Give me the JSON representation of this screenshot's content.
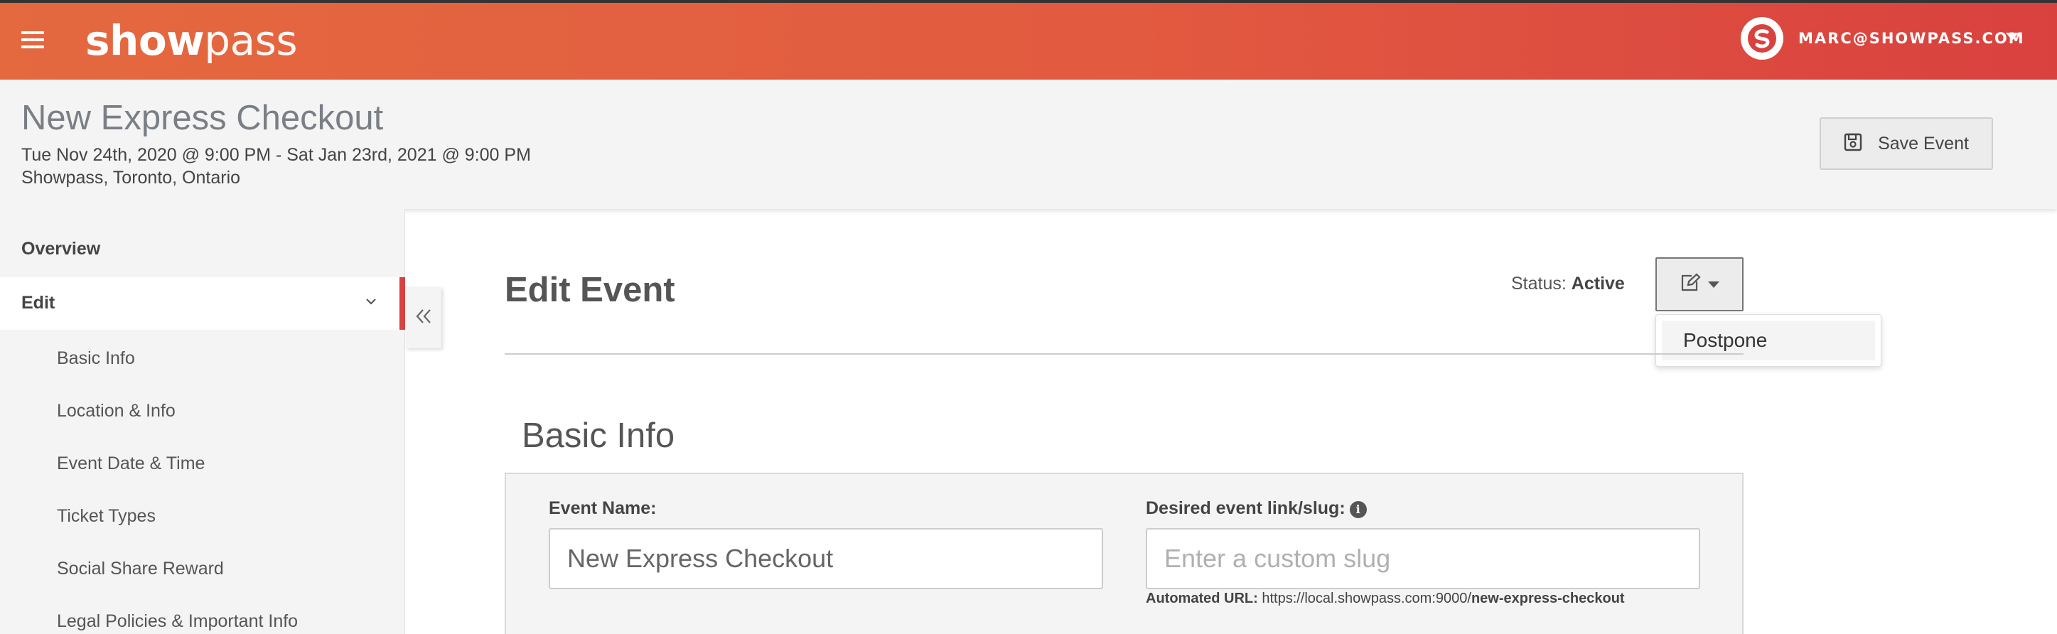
{
  "topbar": {
    "logo_bold": "show",
    "logo_light": "pass",
    "user_email": "MARC@SHOWPASS.COM",
    "brand_gradient": [
      "#e4693f",
      "#d9413f"
    ]
  },
  "event": {
    "title": "New Express Checkout",
    "dates": "Tue Nov 24th, 2020 @ 9:00 PM - Sat Jan 23rd, 2021 @ 9:00 PM",
    "venue": "Showpass, Toronto, Ontario",
    "save_label": "Save Event"
  },
  "sidebar": {
    "overview": "Overview",
    "edit": "Edit",
    "sub_items": [
      {
        "label": "Basic Info"
      },
      {
        "label": "Location & Info"
      },
      {
        "label": "Event Date & Time"
      },
      {
        "label": "Ticket Types"
      },
      {
        "label": "Social Share Reward"
      },
      {
        "label": "Legal Policies & Important Info"
      }
    ],
    "active_color": "#d9413f"
  },
  "main": {
    "title": "Edit Event",
    "status_label": "Status:",
    "status_value": "Active",
    "dropdown_items": [
      {
        "label": "Postpone"
      }
    ],
    "section_title": "Basic Info",
    "form": {
      "event_name_label": "Event Name:",
      "event_name_value": "New Express Checkout",
      "slug_label": "Desired event link/slug:",
      "slug_placeholder": "Enter a custom slug",
      "automated_url_label": "Automated URL:",
      "automated_url_base": "https://local.showpass.com:9000/",
      "automated_url_slug": "new-express-checkout"
    }
  }
}
